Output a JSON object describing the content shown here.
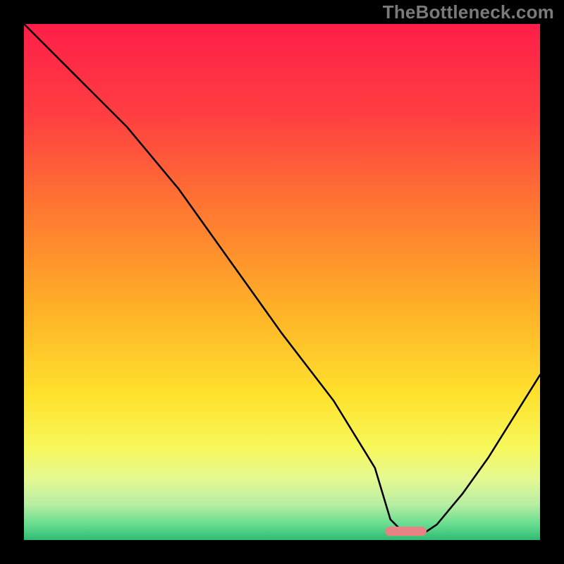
{
  "watermark_text": "TheBottleneck.com",
  "chart_data": {
    "type": "line",
    "title": "",
    "xlabel": "",
    "ylabel": "",
    "xlim": [
      0,
      100
    ],
    "ylim": [
      0,
      100
    ],
    "grid": false,
    "legend": false,
    "curve": {
      "name": "bottleneck-curve",
      "x": [
        0,
        10,
        20,
        25,
        30,
        40,
        50,
        60,
        68,
        71,
        74,
        77,
        80,
        85,
        90,
        95,
        100
      ],
      "y": [
        100,
        90,
        80,
        74,
        68,
        54,
        40,
        27,
        14,
        4,
        1,
        1,
        3,
        9,
        16,
        24,
        32
      ]
    },
    "marker": {
      "name": "optimal-marker",
      "x_center": 74,
      "x_half_width": 4,
      "y": 0.8,
      "color": "#e98284"
    },
    "background": {
      "type": "vertical-gradient",
      "stops": [
        {
          "pos": 0.0,
          "color": "#ff1e49"
        },
        {
          "pos": 0.18,
          "color": "#ff3f41"
        },
        {
          "pos": 0.35,
          "color": "#ff7532"
        },
        {
          "pos": 0.55,
          "color": "#ffb028"
        },
        {
          "pos": 0.72,
          "color": "#ffe22d"
        },
        {
          "pos": 0.82,
          "color": "#f7f85a"
        },
        {
          "pos": 0.88,
          "color": "#e6f991"
        },
        {
          "pos": 0.93,
          "color": "#b9eea3"
        },
        {
          "pos": 0.97,
          "color": "#66dd8f"
        },
        {
          "pos": 1.0,
          "color": "#2fbb71"
        }
      ]
    }
  }
}
